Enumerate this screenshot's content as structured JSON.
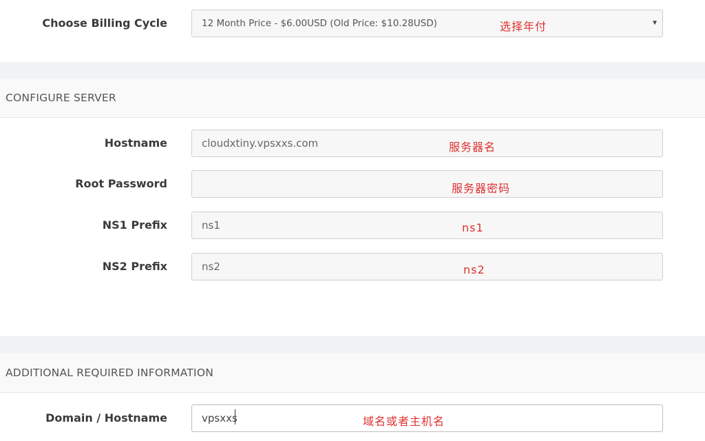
{
  "billing": {
    "label": "Choose Billing Cycle",
    "selected": "12 Month Price - $6.00USD (Old Price: $10.28USD)",
    "annotation": "选择年付"
  },
  "configure_server": {
    "header": "CONFIGURE SERVER",
    "hostname": {
      "label": "Hostname",
      "value": "cloudxtiny.vpsxxs.com",
      "annotation": "服务器名"
    },
    "root_password": {
      "label": "Root Password",
      "value": "",
      "annotation": "服务器密码"
    },
    "ns1": {
      "label": "NS1 Prefix",
      "value": "ns1",
      "annotation": "ns1"
    },
    "ns2": {
      "label": "NS2 Prefix",
      "value": "ns2",
      "annotation": "ns2"
    }
  },
  "additional_info": {
    "header": "ADDITIONAL REQUIRED INFORMATION",
    "domain": {
      "label": "Domain / Hostname",
      "value": "vpsxxs",
      "annotation": "域名或者主机名"
    }
  },
  "icons": {
    "dropdown": "caret-down-icon"
  },
  "colors": {
    "annotation": "#e03030",
    "band": "#f1f2f4",
    "field_bg": "#f7f7f7"
  }
}
